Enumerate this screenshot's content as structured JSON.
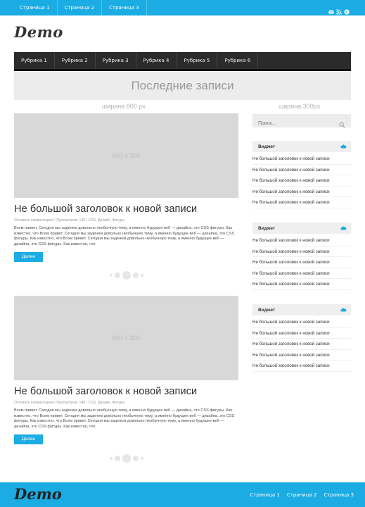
{
  "topbar": {
    "nav": [
      "Страница 1",
      "Страница 2",
      "Страница 3"
    ],
    "icons": [
      "mail-icon",
      "rss-icon",
      "skype-icon"
    ],
    "accent": "#1aace3"
  },
  "logo": "Demo",
  "categories": [
    "Рубрика 1",
    "Рубрика 2",
    "Рубрика 3",
    "Рубрика 4",
    "Рубрика 5",
    "Рубрика 6"
  ],
  "banner": "Последние записи",
  "labels": {
    "main_width": "ширина 800 px",
    "sidebar_width": "ширина 300px"
  },
  "posts": [
    {
      "thumb": "800 x 300",
      "title": "Не большой заголовок к новой записи",
      "meta": "Оставить комментарий / Просмотров: 140 / CSS, Дизайн, Фигуры",
      "excerpt": "Всем привет. Сегодня мы заденем довольно необычную тему, а именно будущее веб — дизайна, это CSS фигуры. Как известно, что Всем привет. Сегодня мы заденем довольно необычную тему, а именно будущее веб — дизайна, это CSS фигуры. Как известно, что Всем привет. Сегодня мы заденем довольно необычную тему, а именно будущее веб — дизайна, это CSS фигуры. Как известно, что",
      "more": "Далее"
    },
    {
      "thumb": "800 x 300",
      "title": "Не большой заголовок к новой записи",
      "meta": "Оставить комментарий / Просмотров: 140 / CSS, Дизайн, Фигуры",
      "excerpt": "Всем привет. Сегодня мы заденем довольно необычную тему, а именно будущее веб — дизайна, это CSS фигуры. Как известно, что Всем привет. Сегодня мы заденем довольно необычную тему, а именно будущее веб — дизайна, это CSS фигуры. Как известно, что Всем привет. Сегодня мы заденем довольно необычную тему, а именно будущее веб — дизайна, это CSS фигуры. Как известно, что",
      "more": "Далее"
    }
  ],
  "search": {
    "placeholder": "Поиск..."
  },
  "widgets": [
    {
      "title": "Виджет",
      "items": [
        "Не большой заголовок к новой записи",
        "Не большой заголовок к новой записи",
        "Не большой заголовок к новой записи",
        "Не большой заголовок к новой записи",
        "Не большой заголовок к новой записи"
      ]
    },
    {
      "title": "Виджет",
      "items": [
        "Не большой заголовок к новой записи",
        "Не большой заголовок к новой записи",
        "Не большой заголовок к новой записи",
        "Не большой заголовок к новой записи",
        "Не большой заголовок к новой записи"
      ]
    },
    {
      "title": "Виджет",
      "items": [
        "Не большой заголовок к новой записи",
        "Не большой заголовок к новой записи",
        "Не большой заголовок к новой записи",
        "Не большой заголовок к новой записи",
        "Не большой заголовок к новой записи"
      ]
    }
  ],
  "footer": {
    "logo": "Demo",
    "nav": [
      "Страница 1",
      "Страница 2",
      "Страница 3"
    ]
  }
}
